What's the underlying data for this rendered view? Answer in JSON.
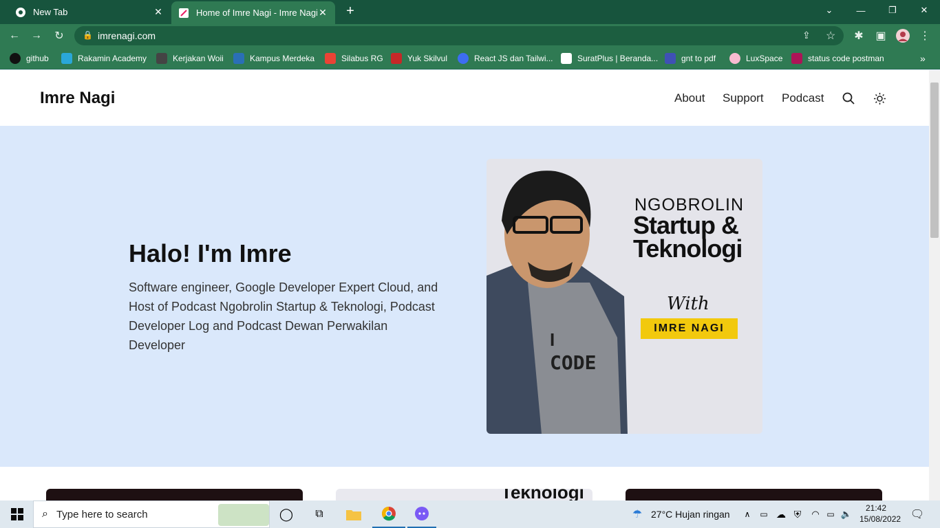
{
  "browser": {
    "tabs": [
      {
        "label": "New Tab",
        "active": false
      },
      {
        "label": "Home of Imre Nagi - Imre Nagi",
        "active": true
      }
    ],
    "url": "imrenagi.com",
    "bookmarks": [
      {
        "label": "github",
        "color": "#111111"
      },
      {
        "label": "Rakamin Academy",
        "color": "#2aa7d8"
      },
      {
        "label": "Kerjakan Woii",
        "color": "#444444"
      },
      {
        "label": "Kampus Merdeka",
        "color": "#2a6fb6"
      },
      {
        "label": "Silabus RG",
        "color": "#ea4335"
      },
      {
        "label": "Yuk Skilvul",
        "color": "#c62828"
      },
      {
        "label": "React JS dan Tailwi...",
        "color": "#3d6df2"
      },
      {
        "label": "SuratPlus | Beranda...",
        "color": "#ffffff"
      },
      {
        "label": "gnt to pdf",
        "color": "#3f51b5"
      },
      {
        "label": "LuxSpace",
        "color": "#f8bbd0"
      },
      {
        "label": "status code postman",
        "color": "#ad1457"
      }
    ]
  },
  "site": {
    "logo": "Imre Nagi",
    "nav": [
      "About",
      "Support",
      "Podcast"
    ],
    "hero": {
      "title": "Halo! I'm Imre",
      "description": "Software engineer, Google Developer Expert Cloud, and Host of Podcast Ngobrolin Startup & Teknologi, Podcast Developer Log and Podcast Dewan Perwakilan Developer"
    },
    "podcast_art": {
      "line1": "NGOBROLIN",
      "line2": "Startup &",
      "line3": "Teknologi",
      "with": "With",
      "host": "IMRE NAGI",
      "shirt_text_1": "I",
      "shirt_text_2": "CODE"
    },
    "cards_peek_text": "Teknologi"
  },
  "taskbar": {
    "search_placeholder": "Type here to search",
    "weather": "27°C  Hujan ringan",
    "time": "21:42",
    "date": "15/08/2022"
  },
  "colors": {
    "tab_strip": "#17543d",
    "toolbar": "#2f7a53",
    "hero_bg": "#dae8fb",
    "host_badge": "#f2c90d"
  }
}
